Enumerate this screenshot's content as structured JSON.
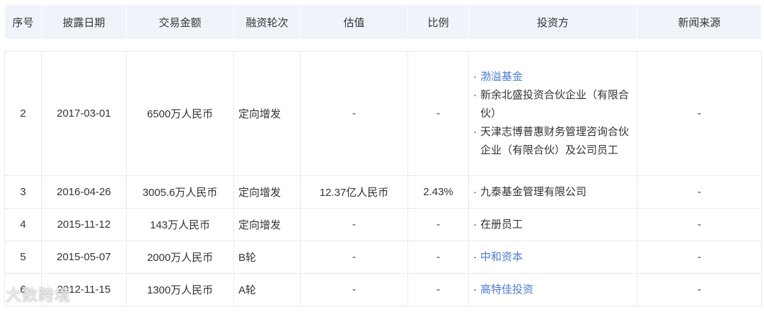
{
  "headers": [
    "序号",
    "披露日期",
    "交易金额",
    "融资轮次",
    "估值",
    "比例",
    "投资方",
    "新闻来源"
  ],
  "rows": [
    {
      "idx": "2",
      "date": "2017-03-01",
      "amount": "6500万人民币",
      "round": "定向增发",
      "valuation": "-",
      "ratio": "-",
      "investors": [
        {
          "text": "渤溢基金",
          "link": true
        },
        {
          "text": "新余北盛投资合伙企业（有限合伙）",
          "link": false
        },
        {
          "text": "天津志博普惠财务管理咨询合伙企业（有限合伙）及公司员工",
          "link": false
        }
      ],
      "news": "-"
    },
    {
      "idx": "3",
      "date": "2016-04-26",
      "amount": "3005.6万人民币",
      "round": "定向增发",
      "valuation": "12.37亿人民币",
      "ratio": "2.43%",
      "investors": [
        {
          "text": "九泰基金管理有限公司",
          "link": false
        }
      ],
      "news": "-"
    },
    {
      "idx": "4",
      "date": "2015-11-12",
      "amount": "143万人民币",
      "round": "定向增发",
      "valuation": "-",
      "ratio": "-",
      "investors": [
        {
          "text": "在册员工",
          "link": false
        }
      ],
      "news": "-"
    },
    {
      "idx": "5",
      "date": "2015-05-07",
      "amount": "2000万人民币",
      "round": "B轮",
      "valuation": "-",
      "ratio": "-",
      "investors": [
        {
          "text": "中和资本",
          "link": true
        }
      ],
      "news": "-"
    },
    {
      "idx": "6",
      "date": "2012-11-15",
      "amount": "1300万人民币",
      "round": "A轮",
      "valuation": "-",
      "ratio": "-",
      "investors": [
        {
          "text": "高特佳投资",
          "link": true
        }
      ],
      "news": "-"
    }
  ],
  "watermark": "大数跨境",
  "colors": {
    "header_bg": "#eef4fa",
    "link": "#4a7bd0",
    "border": "#e6e9ee"
  }
}
